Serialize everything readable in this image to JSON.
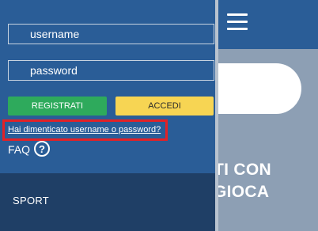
{
  "background": {
    "promo_line1": "TI CON",
    "promo_line2": "GIOCA"
  },
  "drawer": {
    "username_placeholder": "username",
    "password_placeholder": "password",
    "register_label": "REGISTRATI",
    "login_label": "ACCEDI",
    "forgot_label": "Hai dimenticato username o password?",
    "faq_label": "FAQ",
    "faq_icon": "?",
    "sport_label": "SPORT"
  },
  "colors": {
    "drawer_bg": "#2a5d97",
    "register": "#2eaa5c",
    "login": "#f7d553",
    "highlight": "#e32126"
  }
}
